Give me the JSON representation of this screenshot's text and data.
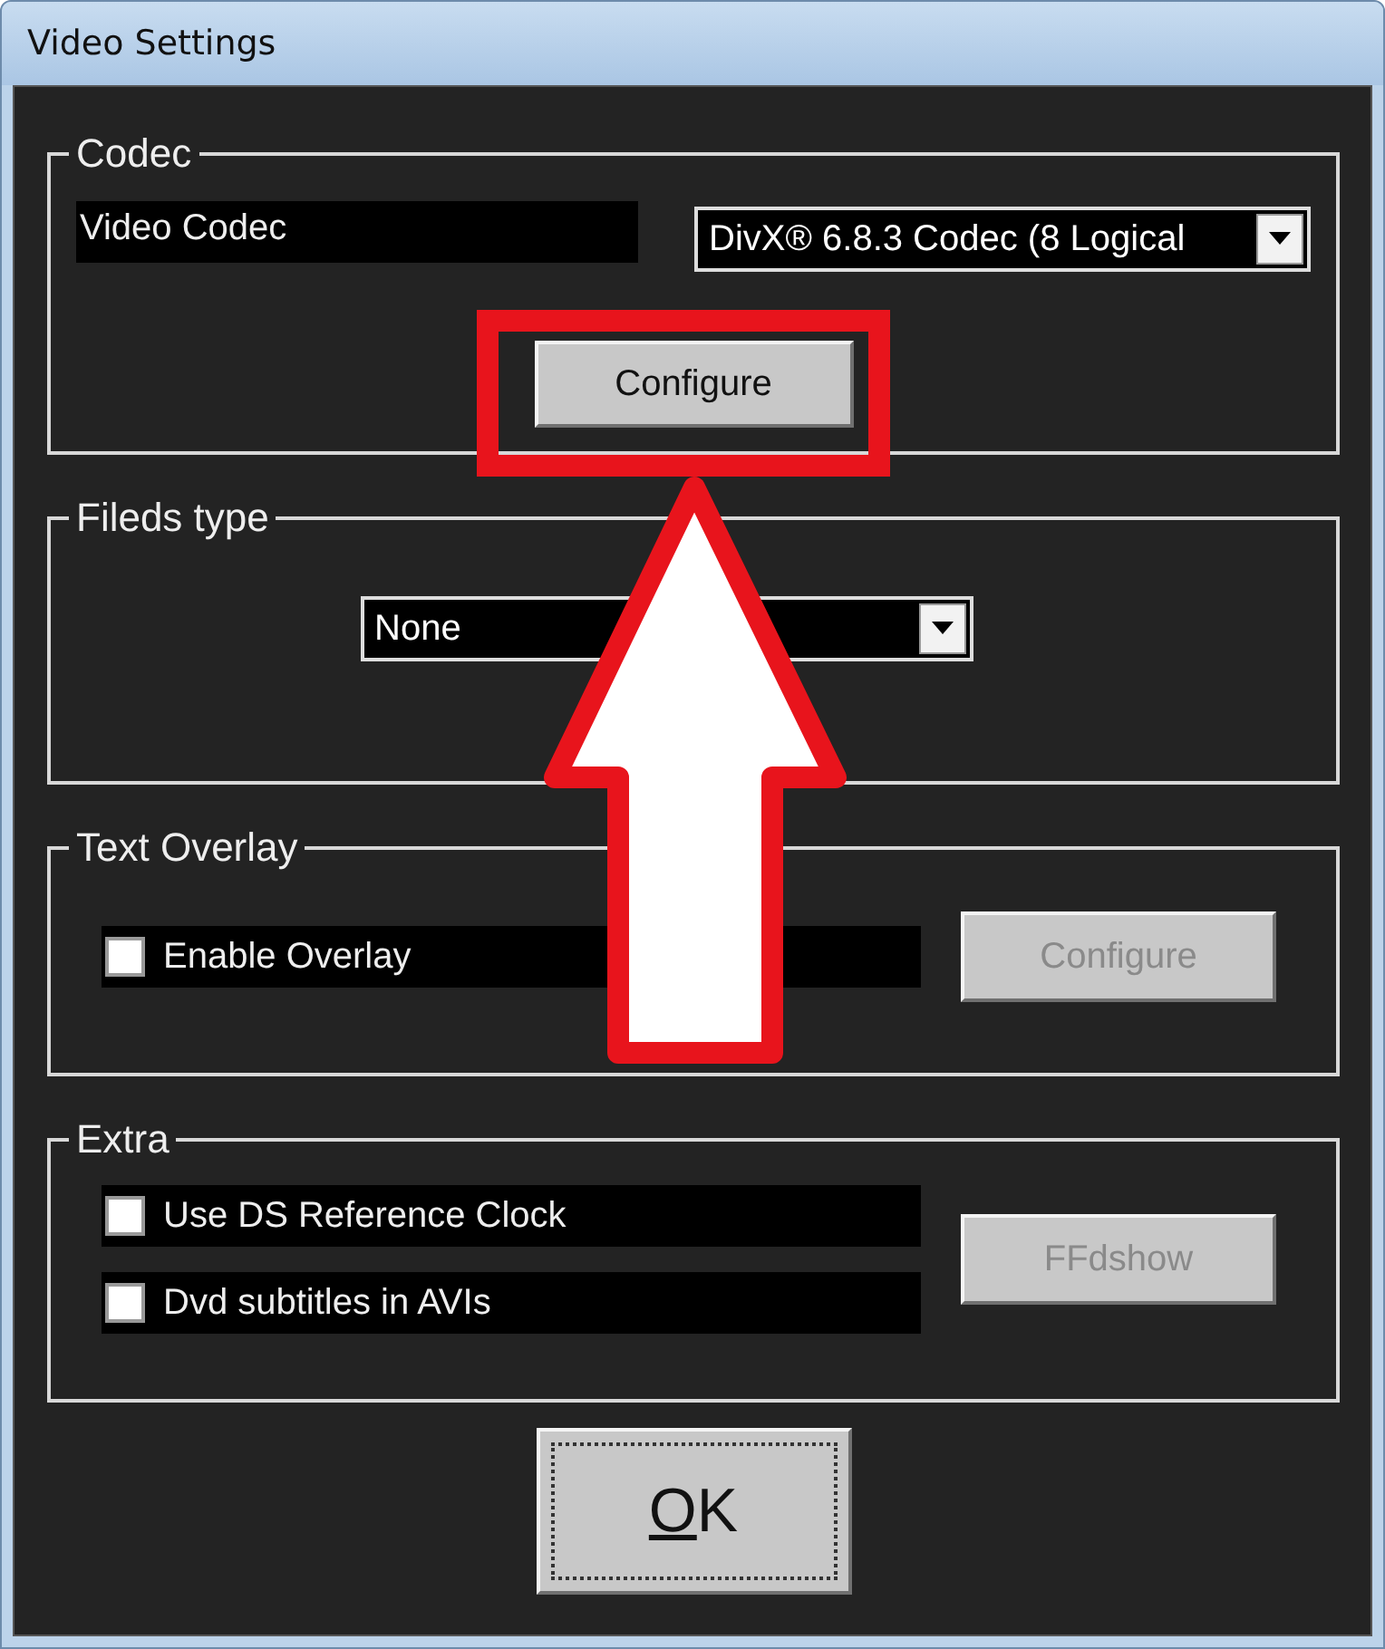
{
  "window": {
    "title": "Video Settings"
  },
  "codec": {
    "title": "Codec",
    "label": "Video Codec",
    "dropdown": {
      "value": "DivX® 6.8.3 Codec (8 Logical"
    },
    "button": {
      "label": "Configure",
      "disabled": false
    }
  },
  "fields_type": {
    "title": "Fileds type",
    "dropdown": {
      "value": "None"
    }
  },
  "text_overlay": {
    "title": "Text Overlay",
    "checkboxes": [
      {
        "label": "Enable Overlay",
        "checked": false
      }
    ],
    "button": {
      "label": "Configure",
      "disabled": true
    }
  },
  "extra": {
    "title": "Extra",
    "checkboxes": [
      {
        "label": "Use DS Reference Clock",
        "checked": false
      },
      {
        "label": "Dvd subtitles in AVIs",
        "checked": false
      }
    ],
    "button": {
      "label": "FFdshow",
      "disabled": true
    }
  },
  "ok_button": {
    "label_parts": [
      {
        "text": "O",
        "underlined": true
      },
      {
        "text": "K",
        "underlined": false
      }
    ]
  }
}
